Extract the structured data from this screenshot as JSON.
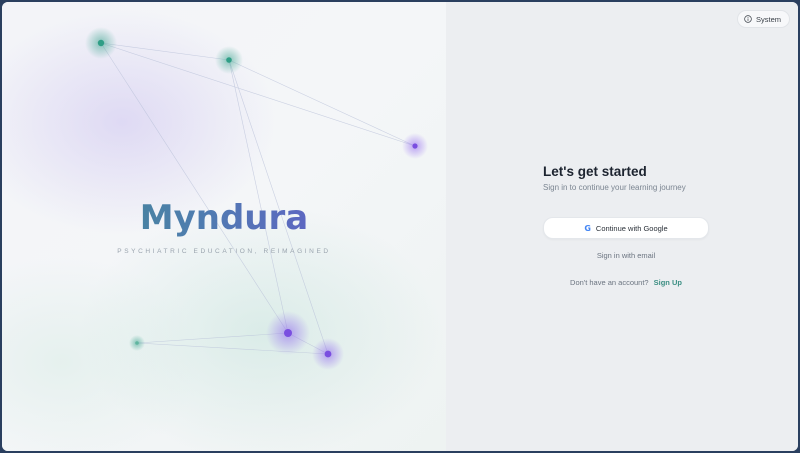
{
  "brand": {
    "name": "Myndura",
    "tagline": "PSYCHIATRIC EDUCATION, REIMAGINED"
  },
  "theme_toggle": {
    "label": "System",
    "icon": "info-icon"
  },
  "auth": {
    "title": "Let's get started",
    "subtitle": "Sign in to continue your learning journey",
    "google_button_label": "Continue with Google",
    "google_icon": "google-icon",
    "email_link_label": "Sign in with email",
    "signup_prompt": "Don't have an account?",
    "signup_link_label": "Sign Up"
  },
  "colors": {
    "brand_teal": "#3c8f86",
    "brand_purple": "#6f4bd8",
    "accent_link": "#3d8f84",
    "node_teal": "#2f9e86",
    "node_purple": "#7a4ee0"
  }
}
